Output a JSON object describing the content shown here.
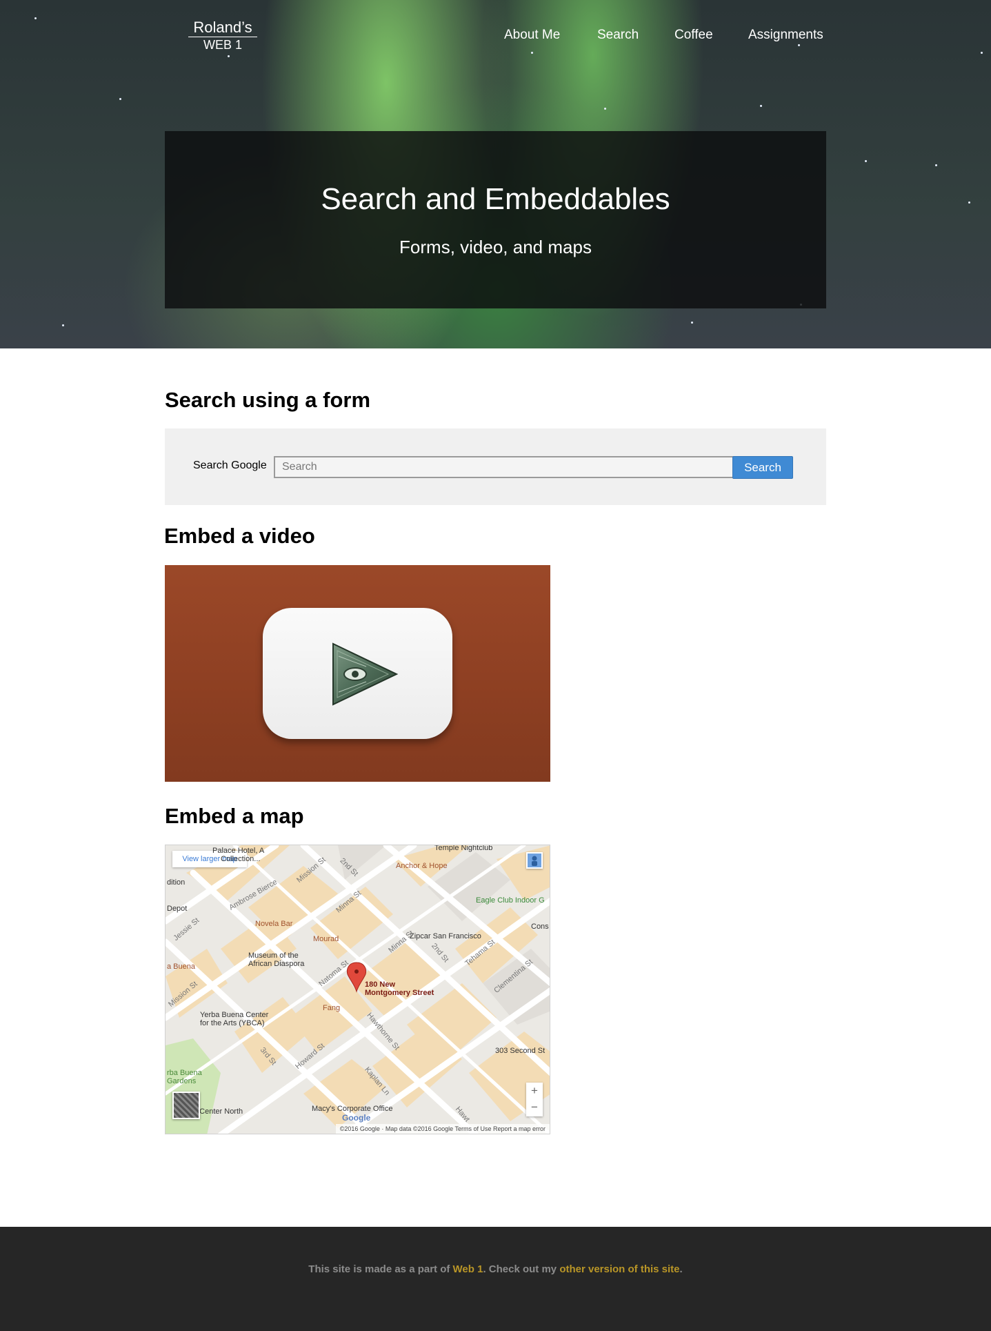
{
  "brand": {
    "line1": "Roland’s",
    "line2": "WEB 1"
  },
  "nav": [
    {
      "label": "About Me"
    },
    {
      "label": "Search"
    },
    {
      "label": "Coffee"
    },
    {
      "label": "Assignments"
    }
  ],
  "hero": {
    "title": "Search and Embeddables",
    "subtitle": "Forms, video, and maps"
  },
  "search_section": {
    "heading": "Search using a form",
    "label": "Search Google",
    "placeholder": "Search",
    "button": "Search"
  },
  "video_section": {
    "heading": "Embed a video"
  },
  "map_section": {
    "heading": "Embed a map",
    "larger_map": "View larger map",
    "pin_label_1": "180 New",
    "pin_label_2": "Montgomery Street",
    "places": [
      "Temple Nightclub",
      "Anchor & Hope",
      "Eagle Club Indoor G",
      "Novela Bar",
      "Mourad",
      "Zipcar San Francisco",
      "Museum of the",
      "African Diaspora",
      "Yerba Buena Center",
      "for the Arts (YBCA)",
      "Fang",
      "303 Second St",
      "Macy's Corporate Office",
      "Palace Hotel, A",
      "Collection...",
      "Depot",
      "a Buena",
      "Cons",
      "rba Buena",
      "Gardens",
      "e Center North",
      "dition",
      "Ambrose Bierce"
    ],
    "streets": [
      "Mission St",
      "2nd St",
      "Minna St",
      "Natoma St",
      "Jessie St",
      "Tehama St",
      "Clementina St",
      "Hawthorne St",
      "Howard St",
      "3rd St",
      "Kaplan Ln",
      "Hawt"
    ],
    "zoom_in": "+",
    "zoom_out": "−",
    "logo": "Google",
    "attribution": "©2016 Google · Map data ©2016 Google     Terms of Use     Report a map error"
  },
  "footer": {
    "prefix": "This site is made as a part of ",
    "link1": "Web 1",
    "middle": ". Check out my ",
    "link2": "other version of this site",
    "suffix": "."
  },
  "colors": {
    "accent": "#3f8ad4",
    "footer_bg": "#262626",
    "footer_link": "#b99627",
    "video_bg": "#9b4828"
  }
}
